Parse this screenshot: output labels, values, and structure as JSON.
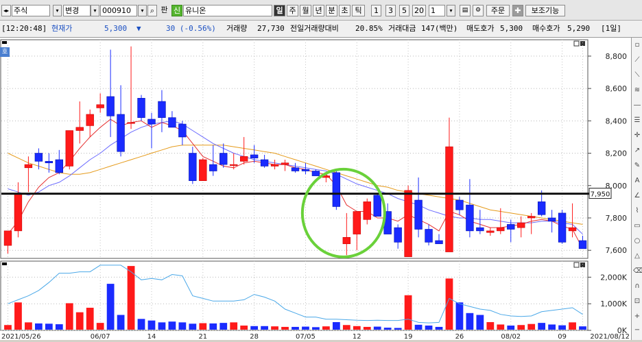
{
  "toolbar": {
    "market_type": "주식",
    "mode": "변경",
    "code": "000910",
    "pan_label": "판",
    "shin_label": "신",
    "name": "유니온",
    "periods": [
      "일",
      "주",
      "월",
      "년",
      "분",
      "초",
      "틱"
    ],
    "active_period": "일",
    "intervals": [
      "1",
      "3",
      "5",
      "20"
    ],
    "interval_value": "1",
    "order_label": "주문",
    "aux_label": "보조기능",
    "search_icon": "search-icon",
    "plus_icon": "plus-icon"
  },
  "quote": {
    "time": "[12:20:48]",
    "current_label": "현재가",
    "current_value": "5,300",
    "change_arrow": "▼",
    "change": "30 (-0.56%)",
    "volume_label": "거래량",
    "volume": "27,730",
    "prev_ratio_label": "전일거래량대비",
    "prev_ratio": "20.85%",
    "amount_label": "거래대금",
    "amount": "147(백만)",
    "ask_label": "매도호가",
    "ask": "5,300",
    "bid_label": "매수호가",
    "bid": "5,290",
    "period_tag": "[1일]"
  },
  "chart_panel": {
    "corner_tag": "호",
    "hline_label": "7,950"
  },
  "chart_data": [
    {
      "type": "candlestick",
      "y_ticks": [
        "8,800",
        "8,600",
        "8,400",
        "8,200",
        "8,000",
        "7,800",
        "7,600"
      ],
      "ylim": [
        7550,
        8880
      ],
      "x_labels": [
        "2021/05/26",
        "06/07",
        "14",
        "21",
        "28",
        "07/05",
        "12",
        "19",
        "26",
        "08/02",
        "09",
        "2021/08/12"
      ],
      "horizontal_line": 7950,
      "candles": [
        {
          "o": 7630,
          "h": 7720,
          "l": 7580,
          "c": 7720
        },
        {
          "o": 7720,
          "h": 8020,
          "l": 7680,
          "c": 7950
        },
        {
          "o": 8110,
          "h": 8180,
          "l": 7960,
          "c": 8130
        },
        {
          "o": 8200,
          "h": 8230,
          "l": 8100,
          "c": 8150
        },
        {
          "o": 8150,
          "h": 8200,
          "l": 8080,
          "c": 8140
        },
        {
          "o": 8160,
          "h": 8220,
          "l": 8070,
          "c": 8080
        },
        {
          "o": 8120,
          "h": 8330,
          "l": 8100,
          "c": 8340
        },
        {
          "o": 8340,
          "h": 8520,
          "l": 8260,
          "c": 8360
        },
        {
          "o": 8370,
          "h": 8470,
          "l": 8300,
          "c": 8440
        },
        {
          "o": 8480,
          "h": 8570,
          "l": 8450,
          "c": 8500
        },
        {
          "o": 8550,
          "h": 8840,
          "l": 8300,
          "c": 8430
        },
        {
          "o": 8440,
          "h": 8620,
          "l": 8180,
          "c": 8210
        },
        {
          "o": 8390,
          "h": 8860,
          "l": 8350,
          "c": 8390
        },
        {
          "o": 8540,
          "h": 8560,
          "l": 8400,
          "c": 8420
        },
        {
          "o": 8410,
          "h": 8450,
          "l": 8230,
          "c": 8380
        },
        {
          "o": 8520,
          "h": 8590,
          "l": 8330,
          "c": 8420
        },
        {
          "o": 8420,
          "h": 8460,
          "l": 8370,
          "c": 8360
        },
        {
          "o": 8380,
          "h": 8400,
          "l": 8250,
          "c": 8300
        },
        {
          "o": 8200,
          "h": 8240,
          "l": 8010,
          "c": 8030
        },
        {
          "o": 8030,
          "h": 8170,
          "l": 8030,
          "c": 8160
        },
        {
          "o": 8130,
          "h": 8250,
          "l": 8060,
          "c": 8090
        },
        {
          "o": 8200,
          "h": 8260,
          "l": 8110,
          "c": 8130
        },
        {
          "o": 8130,
          "h": 8200,
          "l": 8100,
          "c": 8130
        },
        {
          "o": 8150,
          "h": 8300,
          "l": 8130,
          "c": 8180
        },
        {
          "o": 8190,
          "h": 8250,
          "l": 8140,
          "c": 8170
        },
        {
          "o": 8160,
          "h": 8190,
          "l": 8110,
          "c": 8120
        },
        {
          "o": 8120,
          "h": 8160,
          "l": 8100,
          "c": 8130
        },
        {
          "o": 8130,
          "h": 8160,
          "l": 8090,
          "c": 8140
        },
        {
          "o": 8110,
          "h": 8140,
          "l": 8080,
          "c": 8090
        },
        {
          "o": 8100,
          "h": 8140,
          "l": 8070,
          "c": 8090
        },
        {
          "o": 8090,
          "h": 8100,
          "l": 8060,
          "c": 8060
        },
        {
          "o": 8050,
          "h": 8070,
          "l": 8020,
          "c": 8060
        },
        {
          "o": 8080,
          "h": 8100,
          "l": 7850,
          "c": 7870
        },
        {
          "o": 7640,
          "h": 7830,
          "l": 7570,
          "c": 7680
        },
        {
          "o": 7700,
          "h": 7830,
          "l": 7600,
          "c": 7840
        },
        {
          "o": 7790,
          "h": 7920,
          "l": 7760,
          "c": 7900
        },
        {
          "o": 7940,
          "h": 7950,
          "l": 7820,
          "c": 7810
        },
        {
          "o": 7840,
          "h": 7890,
          "l": 7700,
          "c": 7700
        },
        {
          "o": 7740,
          "h": 7760,
          "l": 7610,
          "c": 7650
        },
        {
          "o": 7560,
          "h": 8000,
          "l": 7560,
          "c": 7970
        },
        {
          "o": 7910,
          "h": 8050,
          "l": 7680,
          "c": 7730
        },
        {
          "o": 7730,
          "h": 7760,
          "l": 7630,
          "c": 7650
        },
        {
          "o": 7660,
          "h": 7700,
          "l": 7640,
          "c": 7640
        },
        {
          "o": 7590,
          "h": 8420,
          "l": 7590,
          "c": 8240
        },
        {
          "o": 7910,
          "h": 7930,
          "l": 7820,
          "c": 7850
        },
        {
          "o": 7880,
          "h": 8040,
          "l": 7680,
          "c": 7720
        },
        {
          "o": 7740,
          "h": 7850,
          "l": 7700,
          "c": 7720
        },
        {
          "o": 7710,
          "h": 7740,
          "l": 7690,
          "c": 7720
        },
        {
          "o": 7720,
          "h": 7860,
          "l": 7700,
          "c": 7740
        },
        {
          "o": 7760,
          "h": 7790,
          "l": 7650,
          "c": 7730
        },
        {
          "o": 7740,
          "h": 7810,
          "l": 7680,
          "c": 7770
        },
        {
          "o": 7800,
          "h": 7830,
          "l": 7700,
          "c": 7810
        },
        {
          "o": 7900,
          "h": 7970,
          "l": 7810,
          "c": 7820
        },
        {
          "o": 7800,
          "h": 7850,
          "l": 7710,
          "c": 7780
        },
        {
          "o": 7830,
          "h": 7850,
          "l": 7640,
          "c": 7650
        },
        {
          "o": 7720,
          "h": 7890,
          "l": 7680,
          "c": 7740
        },
        {
          "o": 7660,
          "h": 7690,
          "l": 7610,
          "c": 7610
        }
      ],
      "ma_short": [
        7700,
        7780,
        7900,
        7990,
        8050,
        8080,
        8150,
        8230,
        8300,
        8360,
        8410,
        8370,
        8390,
        8400,
        8360,
        8390,
        8370,
        8340,
        8260,
        8180,
        8150,
        8120,
        8110,
        8140,
        8150,
        8140,
        8130,
        8130,
        8110,
        8100,
        8080,
        8070,
        8000,
        7880,
        7840,
        7840,
        7800,
        7800,
        7780,
        7820,
        7790,
        7760,
        7720,
        7840,
        7820,
        7780,
        7760,
        7740,
        7740,
        7750,
        7760,
        7780,
        7790,
        7780,
        7750,
        7730,
        7610
      ],
      "ma_mid": [
        7980,
        7960,
        7940,
        7960,
        8000,
        8020,
        8060,
        8110,
        8160,
        8200,
        8250,
        8290,
        8330,
        8360,
        8380,
        8390,
        8400,
        8380,
        8340,
        8300,
        8260,
        8230,
        8200,
        8180,
        8160,
        8150,
        8140,
        8130,
        8120,
        8110,
        8100,
        8090,
        8070,
        8040,
        8010,
        7990,
        7970,
        7950,
        7920,
        7900,
        7880,
        7850,
        7830,
        7810,
        7800,
        7800,
        7790,
        7790,
        7780,
        7770,
        7770,
        7770,
        7780,
        7780,
        7770,
        7760,
        7700
      ],
      "ma_long": [
        8200,
        8170,
        8140,
        8120,
        8100,
        8080,
        8070,
        8070,
        8080,
        8100,
        8120,
        8140,
        8160,
        8180,
        8200,
        8220,
        8240,
        8250,
        8250,
        8250,
        8250,
        8250,
        8240,
        8230,
        8220,
        8210,
        8200,
        8180,
        8160,
        8140,
        8120,
        8100,
        8080,
        8060,
        8040,
        8020,
        8000,
        7990,
        7970,
        7960,
        7950,
        7940,
        7930,
        7920,
        7910,
        7890,
        7870,
        7850,
        7840,
        7830,
        7820,
        7810,
        7800,
        7790,
        7780,
        7770,
        7760
      ]
    },
    {
      "type": "bar",
      "y_ticks": [
        "2,000K",
        "1,000K",
        "0K"
      ],
      "ylim": [
        0,
        2500
      ],
      "volumes": [
        200,
        1050,
        300,
        260,
        250,
        230,
        1020,
        680,
        850,
        280,
        1750,
        580,
        2420,
        430,
        370,
        300,
        330,
        300,
        250,
        270,
        260,
        280,
        300,
        180,
        160,
        160,
        150,
        130,
        130,
        140,
        120,
        150,
        310,
        200,
        160,
        130,
        140,
        100,
        90,
        1320,
        210,
        180,
        130,
        1950,
        1050,
        650,
        580,
        310,
        220,
        180,
        200,
        240,
        280,
        220,
        190,
        300,
        150
      ],
      "vol_ma": [
        1000,
        1150,
        1300,
        1500,
        1800,
        2150,
        2150,
        2200,
        2200,
        2450,
        2450,
        2450,
        2200,
        1900,
        1950,
        1900,
        2100,
        2050,
        1300,
        1200,
        1100,
        1100,
        1100,
        1150,
        1350,
        1250,
        1100,
        800,
        650,
        500,
        500,
        420,
        420,
        400,
        380,
        370,
        380,
        370,
        370,
        420,
        300,
        280,
        300,
        1200,
        1000,
        900,
        800,
        750,
        600,
        540,
        520,
        540,
        700,
        750,
        800,
        850,
        600
      ]
    }
  ]
}
